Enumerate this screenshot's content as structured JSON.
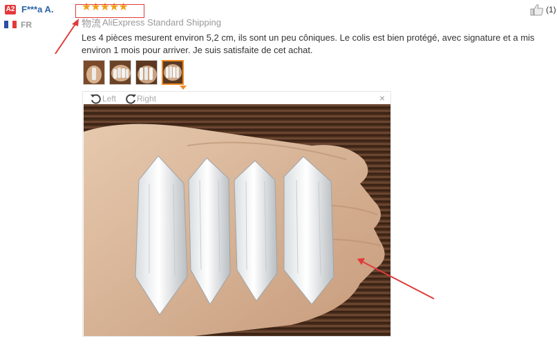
{
  "reviewer": {
    "level_badge": "A2",
    "name": "F***a A.",
    "country": "FR"
  },
  "rating": {
    "stars": 5,
    "display": "★★★★★"
  },
  "shipping": {
    "label": "物流",
    "method": "AliExpress Standard Shipping"
  },
  "review_text": "Les 4 pièces mesurent environ 5,2 cm, ils sont un peu côniques. Le colis est bien protégé, avec signature et a mis environ 1 mois pour arriver. Je suis satisfaite de cet achat.",
  "helpful": {
    "count": "(1)"
  },
  "thumbnails": [
    {
      "icon": "photo-thumbnail",
      "active": false
    },
    {
      "icon": "photo-thumbnail",
      "active": false
    },
    {
      "icon": "photo-thumbnail",
      "active": false
    },
    {
      "icon": "photo-thumbnail",
      "active": true
    }
  ],
  "viewer": {
    "rotate_left_label": "Left",
    "rotate_right_label": "Right",
    "close_glyph": "×"
  },
  "colors": {
    "accent": "#f08a24",
    "star": "#f49f14",
    "annotation": "#e03a3a",
    "name_link": "#2b62a6"
  }
}
